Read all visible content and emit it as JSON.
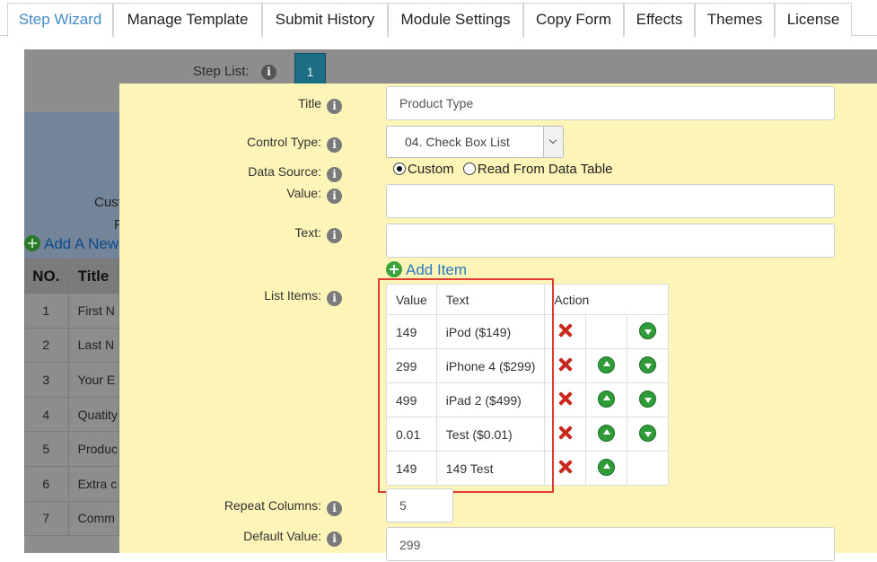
{
  "tabs": [
    {
      "label": "Step Wizard",
      "active": true
    },
    {
      "label": "Manage Template"
    },
    {
      "label": "Submit History"
    },
    {
      "label": "Module Settings"
    },
    {
      "label": "Copy Form"
    },
    {
      "label": "Effects"
    },
    {
      "label": "Themes"
    },
    {
      "label": "License"
    }
  ],
  "background": {
    "step_list_label": "Step List:",
    "step_badge": "1",
    "label_a": "Cust",
    "label_b": "F",
    "add_new": "Add A New",
    "table": {
      "headers": [
        "NO.",
        "Title"
      ],
      "rows": [
        {
          "no": "1",
          "title": "First N"
        },
        {
          "no": "2",
          "title": "Last N"
        },
        {
          "no": "3",
          "title": "Your E"
        },
        {
          "no": "4",
          "title": "Quatity"
        },
        {
          "no": "5",
          "title": "Produc"
        },
        {
          "no": "6",
          "title": "Extra c"
        },
        {
          "no": "7",
          "title": "Comm"
        }
      ]
    }
  },
  "form": {
    "title_label": "Title",
    "title_value": "Product Type",
    "control_type_label": "Control Type:",
    "control_type_value": "04. Check Box List",
    "data_source_label": "Data Source:",
    "data_source_custom": "Custom",
    "data_source_table": "Read From Data Table",
    "value_label": "Value:",
    "value_value": "",
    "text_label": "Text:",
    "text_value": "",
    "add_item": "Add Item",
    "list_items_label": "List Items:",
    "list_headers": {
      "value": "Value",
      "text": "Text",
      "action": "Action"
    },
    "list_items": [
      {
        "value": "149",
        "text": "iPod ($149)",
        "up": false,
        "down": true
      },
      {
        "value": "299",
        "text": "iPhone 4 ($299)",
        "up": true,
        "down": true
      },
      {
        "value": "499",
        "text": "iPad 2 ($499)",
        "up": true,
        "down": true
      },
      {
        "value": "0.01",
        "text": "Test ($0.01)",
        "up": true,
        "down": true
      },
      {
        "value": "149",
        "text": "149 Test",
        "up": true,
        "down": false
      }
    ],
    "repeat_columns_label": "Repeat Columns:",
    "repeat_columns_value": "5",
    "default_value_label": "Default Value:",
    "default_value_value": "299"
  }
}
